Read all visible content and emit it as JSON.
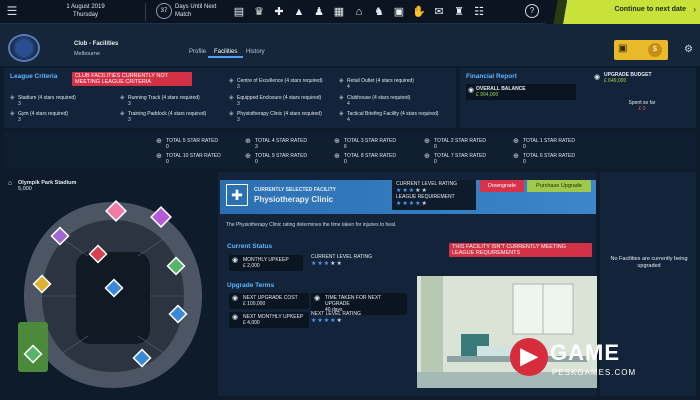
{
  "topbar": {
    "menu_icon": "hamburger-icon",
    "date": "1 August 2019",
    "weekday": "Thursday",
    "days_until": "37",
    "days_label": "Days Until Next Match",
    "tool_icons": [
      "chart-icon",
      "cup-icon",
      "medkit-icon",
      "cone-icon",
      "shirt-icon",
      "board-icon",
      "stadium-icon",
      "kit-icon",
      "calendar-icon",
      "handshake-icon",
      "email-icon",
      "trophy-icon",
      "news-icon"
    ],
    "continue_label": "Continue to next date"
  },
  "club": {
    "name": "Club - Facilities",
    "city": "Melbourne",
    "tabs": [
      "Profile",
      "Facilities",
      "History"
    ],
    "active_tab": "Facilities",
    "coin_label": "$"
  },
  "criteria": {
    "title": "League Criteria",
    "alert": "CLUB FACILITIES CURRENTLY NOT MEETING LEAGUE CRITERIA",
    "items": [
      {
        "label": "Stadium (4 stars required)",
        "value": "3"
      },
      {
        "label": "Running Track (4 stars required)",
        "value": "3"
      },
      {
        "label": "Centre of Excellence (4 stars required)",
        "value": "3"
      },
      {
        "label": "Retail Outlet (4 stars required)",
        "value": "4"
      },
      {
        "label": "Equipped Enclosure (4 stars required)",
        "value": "3"
      },
      {
        "label": "Clubhouse (4 stars required)",
        "value": "4"
      },
      {
        "label": "Gym (4 stars required)",
        "value": "3"
      },
      {
        "label": "Training Paddock (4 stars required)",
        "value": "3"
      },
      {
        "label": "Physiotherapy Clinic (4 stars required)",
        "value": "3"
      },
      {
        "label": "Tactical Briefing Facility (4 stars required)",
        "value": "4"
      }
    ]
  },
  "financial": {
    "title": "Financial Report",
    "balance_label": "OVERALL BALANCE",
    "balance_value": "£ 904,000",
    "budget_label": "UPGRADE BUDGET",
    "budget_value": "£ 649,000",
    "spent_label": "Spent so far",
    "spent_value": "£ 0"
  },
  "star_rated": [
    {
      "label": "TOTAL 5 STAR RATED",
      "value": "0"
    },
    {
      "label": "TOTAL 4 STAR RATED",
      "value": "3"
    },
    {
      "label": "TOTAL 3 STAR RATED",
      "value": "6"
    },
    {
      "label": "TOTAL 2 STAR RATED",
      "value": "0"
    },
    {
      "label": "TOTAL 1 STAR RATED",
      "value": "0"
    },
    {
      "label": "TOTAL 10 STAR RATED",
      "value": "0"
    },
    {
      "label": "TOTAL 9 STAR RATED",
      "value": "0"
    },
    {
      "label": "TOTAL 8 STAR RATED",
      "value": "0"
    },
    {
      "label": "TOTAL 7 STAR RATED",
      "value": "0"
    },
    {
      "label": "TOTAL 6 STAR RATED",
      "value": "0"
    }
  ],
  "stadium": {
    "name": "Olympik Park Stadium",
    "capacity": "5,000"
  },
  "facility": {
    "selected_label": "CURRENTLY SELECTED FACILITY",
    "name": "Physiotherapy Clinic",
    "current_rating_label": "CURRENT LEVEL RATING",
    "current_stars": 3,
    "league_req_label": "LEAGUE REQUIREMENT",
    "league_stars": 4,
    "downgrade_label": "Downgrade",
    "upgrade_label": "Purchase Upgrade",
    "description": "The Physiotherapy Clinic rating determines the time taken for injuries to heal."
  },
  "current_status": {
    "title": "Current Status",
    "alert": "THIS FACILITY ISN'T CURRENTLY MEETING LEAGUE REQUIREMENTS",
    "upkeep_label": "MONTHLY UPKEEP",
    "upkeep_value": "£ 2,000",
    "rating_label": "CURRENT LEVEL RATING",
    "rating_stars": 3
  },
  "upgrade_terms": {
    "title": "Upgrade Terms",
    "next_cost_label": "NEXT UPGRADE COST",
    "next_cost_value": "£ 100,000",
    "time_label": "TIME TAKEN FOR NEXT UPGRADE",
    "time_value": "40 days",
    "next_upkeep_label": "NEXT MONTHLY UPKEEP",
    "next_upkeep_value": "£ 4,000",
    "next_level_label": "NEXT LEVEL RATING",
    "next_level_stars": 4
  },
  "right_panel": {
    "empty_text": "No Facilities are currently being upgraded"
  },
  "watermark": {
    "brand": "GAME",
    "site": "PESKGAMES.COM"
  },
  "colors": {
    "accent": "#4da3ff",
    "continue": "#c9e23a",
    "alert": "#d23146",
    "upgrade": "#9fc94a",
    "coin": "#e9b92c"
  }
}
